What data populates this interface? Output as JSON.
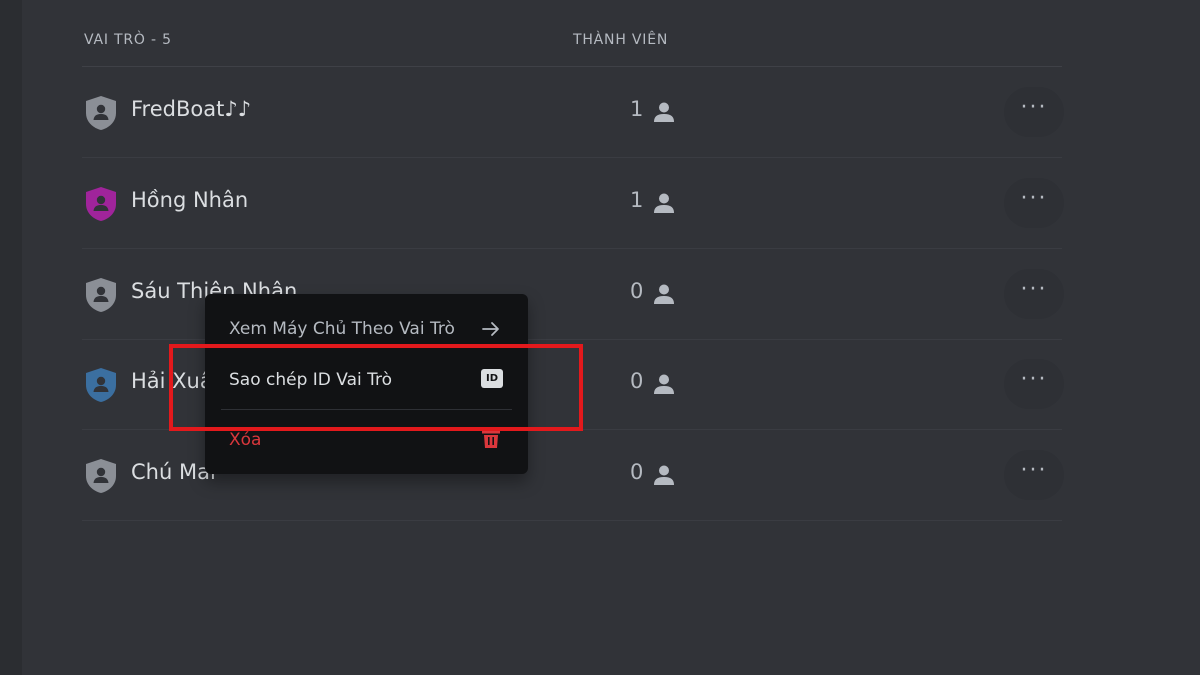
{
  "header": {
    "roles_label": "VAI TRÒ - 5",
    "members_label": "THÀNH VIÊN"
  },
  "roles": [
    {
      "name": "FredBoat♪♪",
      "members": "1",
      "color": "#8b8f96"
    },
    {
      "name": "Hồng Nhân",
      "members": "1",
      "color": "#a0249b"
    },
    {
      "name": "Sáu Thiện Nhân",
      "members": "0",
      "color": "#8b8f96"
    },
    {
      "name": "Hải Xuân",
      "members": "0",
      "color": "#3b6fa0"
    },
    {
      "name": "Chú Mai",
      "members": "0",
      "color": "#8b8f96"
    }
  ],
  "more_label": "···",
  "context_menu": {
    "view_server_as_role": "Xem Máy Chủ Theo Vai Trò",
    "copy_role_id": "Sao chép ID Vai Trò",
    "id_badge": "ID",
    "delete": "Xóa"
  },
  "colors": {
    "background": "#313338",
    "menu_background": "#111214",
    "danger": "#da373c",
    "highlight": "#e3191c"
  },
  "icons": [
    "shield-icon",
    "person-icon",
    "more-icon",
    "arrow-right-icon",
    "id-icon",
    "trash-icon"
  ]
}
